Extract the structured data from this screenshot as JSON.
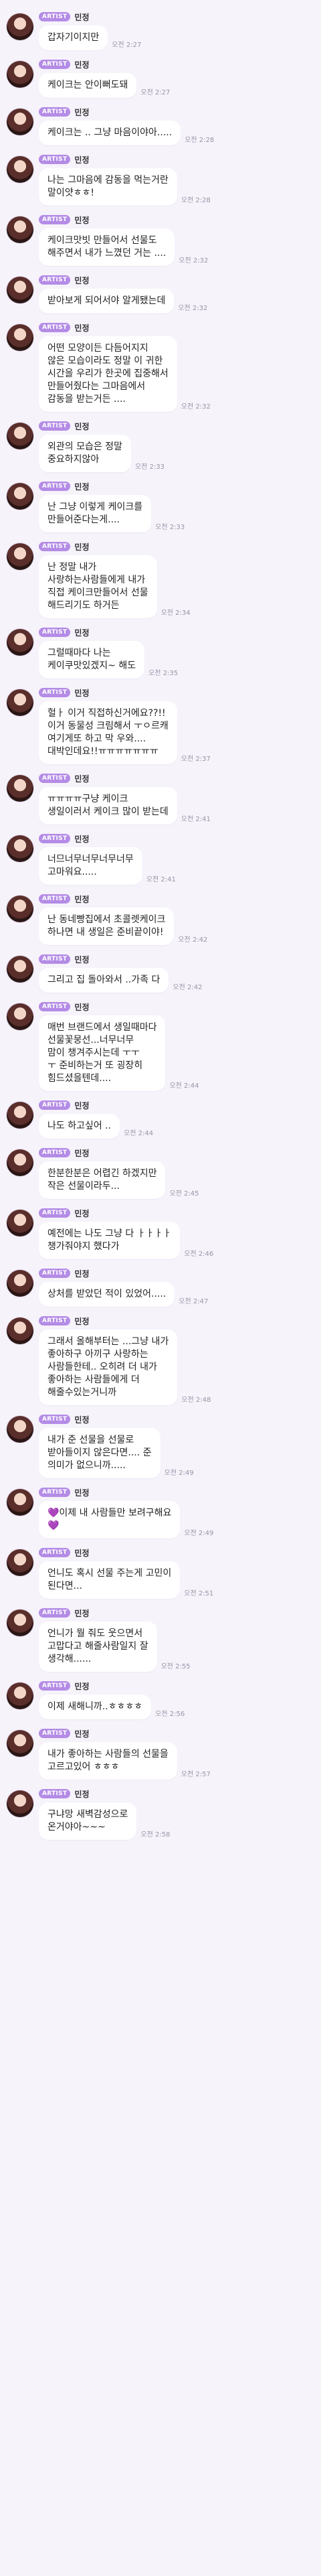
{
  "artist_badge": "ARTIST",
  "messages": [
    {
      "name": "민정",
      "text": "갑자기이지만",
      "time": "오전 2:27"
    },
    {
      "name": "민정",
      "text": "케이크는 안이뻐도돼",
      "time": "오전 2:27"
    },
    {
      "name": "민정",
      "text": "케이크는 .. 그냥 마음이야아.....",
      "time": "오전 2:28"
    },
    {
      "name": "민정",
      "text": "나는 그마음에 감동을 먹는거란\n말이얏ㅎㅎ!",
      "time": "오전 2:28"
    },
    {
      "name": "민정",
      "text": "케이크맛빗 만들어서 선물도\n해주면서 내가 느꼈던 거는 ....",
      "time": "오전 2:32"
    },
    {
      "name": "민정",
      "text": "받아보게 되어서야 알게됐는데",
      "time": "오전 2:32"
    },
    {
      "name": "민정",
      "text": "어떤 모양이든 다듬어지지\n않은 모습이라도 정말 이 귀한\n시간을 우리가 한곳에 집중해서\n만들어줬다는 그마음에서\n감동을 받는거든 ....",
      "time": "오전 2:32"
    },
    {
      "name": "민정",
      "text": "외관의 모습은 정말\n중요하지않아",
      "time": "오전 2:33"
    },
    {
      "name": "민정",
      "text": "난 그냥 이렇게 케이크를\n만들어준다는게....",
      "time": "오전 2:33"
    },
    {
      "name": "민정",
      "text": "난 정말 내가\n사랑하는사람들에게 내가\n직접 케이크만들어서 선물\n해드리기도 하거든",
      "time": "오전 2:34"
    },
    {
      "name": "민정",
      "text": "그럴때마다 나는\n케이쿠맛있겠지~ 해도",
      "time": "오전 2:35"
    },
    {
      "name": "민정",
      "text": "헐ㅏ 이거 직접하신거에요??!!\n이거 동물성 크림해서 ㅜㅇ르캐\n여기게또 하고 막 우와....\n대박인데요!!ㅠㅠㅠㅠㅠㅠㅠ",
      "time": "오전 2:37"
    },
    {
      "name": "민정",
      "text": "ㅠㅠㅠㅠ구냥 케이크\n생일이러서 케이크 많이 받는데",
      "time": "오전 2:41"
    },
    {
      "name": "민정",
      "text": "너므너무너무너무너무\n고마워요.....",
      "time": "오전 2:41"
    },
    {
      "name": "민정",
      "text": "난 동네빵집에서 초콜렛케이크\n하나면 내 생일은 준비끝이야!",
      "time": "오전 2:42"
    },
    {
      "name": "민정",
      "text": "그리고 집 돌아와서 ..가족 다",
      "time": "오전 2:42"
    },
    {
      "name": "민정",
      "text": "매번 브랜드에서 생일때마다\n선물꽃뭉선...너무너무\n맘이 챙겨주시는데 ㅜㅜ\nㅜ 준비하는거 또 굉장히\n힘드셨을텐데....",
      "time": "오전 2:44"
    },
    {
      "name": "민정",
      "text": "나도 하고싶어 ..",
      "time": "오전 2:44"
    },
    {
      "name": "민정",
      "text": "한분한분은 어렵긴 하겠지만\n작은 선물이라두...",
      "time": "오전 2:45"
    },
    {
      "name": "민정",
      "text": "예전에는 나도 그냥 다 ㅏㅏㅏㅏ\n챙가줘야지 했다가",
      "time": "오전 2:46"
    },
    {
      "name": "민정",
      "text": "상처를 받았던 적이 있었어.....",
      "time": "오전 2:47"
    },
    {
      "name": "민정",
      "text": "그래서 올해부터는 ...그냥 내가\n좋아하구 아끼구 사랑하는\n사람들한테.. 오히려 더 내가\n좋아하는 사람들에게 더\n해줄수있는거니까",
      "time": "오전 2:48"
    },
    {
      "name": "민정",
      "text": "내가 준 선물을 선물로\n받아들이지 않은다면.... 준\n의미가 없으니까.....",
      "time": "오전 2:49"
    },
    {
      "name": "민정",
      "text": "💜이제 내 사람들만 보려구해요\n💜",
      "time": "오전 2:49"
    },
    {
      "name": "민정",
      "text": "언니도 혹시 선물 주는게 고민이\n된다면...",
      "time": "오전 2:51"
    },
    {
      "name": "민정",
      "text": "언니가 뭘 줘도 웃으면서\n고맙다고 해줄사람일지 잘\n생각해......",
      "time": "오전 2:55"
    },
    {
      "name": "민정",
      "text": "이제 새해니까..ㅎㅎㅎㅎ",
      "time": "오전 2:56"
    },
    {
      "name": "민정",
      "text": "내가 좋아하는 사람들의 선물을\n고르고있어 ㅎㅎㅎ",
      "time": "오전 2:57"
    },
    {
      "name": "민정",
      "text": "구냐망 새벽감성으로\n온거야아~~~",
      "time": "오전 2:58"
    }
  ]
}
